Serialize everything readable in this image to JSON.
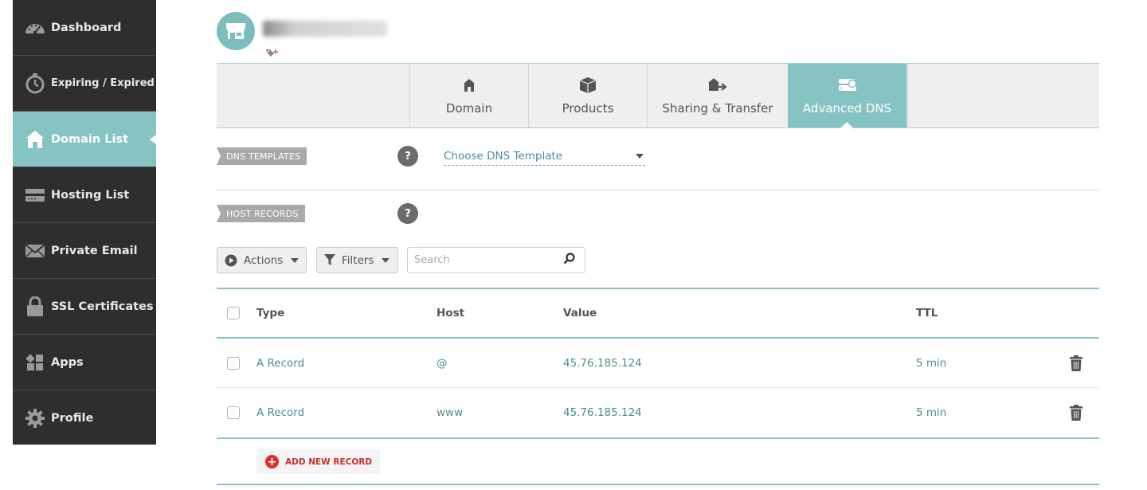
{
  "sidebar": {
    "items": [
      {
        "label": "Dashboard",
        "icon": "speedometer-icon"
      },
      {
        "label": "Expiring / Expired",
        "icon": "stopwatch-icon"
      },
      {
        "label": "Domain List",
        "icon": "home-icon",
        "active": true
      },
      {
        "label": "Hosting List",
        "icon": "server-icon"
      },
      {
        "label": "Private Email",
        "icon": "envelope-icon"
      },
      {
        "label": "SSL Certificates",
        "icon": "lock-icon"
      },
      {
        "label": "Apps",
        "icon": "apps-icon"
      },
      {
        "label": "Profile",
        "icon": "gear-icon"
      }
    ]
  },
  "header": {
    "avatar_icon": "store-icon",
    "tag_icon": "tag-add-icon"
  },
  "tabs": [
    {
      "label": "Domain",
      "icon": "home-icon"
    },
    {
      "label": "Products",
      "icon": "box-icon"
    },
    {
      "label": "Sharing & Transfer",
      "icon": "share-transfer-icon"
    },
    {
      "label": "Advanced DNS",
      "icon": "dns-icon",
      "active": true
    }
  ],
  "dns_templates": {
    "label": "DNS TEMPLATES",
    "help": "?",
    "select_value": "Choose DNS Template"
  },
  "host_records": {
    "label": "HOST RECORDS",
    "help": "?"
  },
  "toolbar": {
    "actions_label": "Actions",
    "filters_label": "Filters",
    "search_placeholder": "Search"
  },
  "table": {
    "columns": {
      "type": "Type",
      "host": "Host",
      "value": "Value",
      "ttl": "TTL"
    },
    "rows": [
      {
        "type": "A Record",
        "host": "@",
        "value": "45.76.185.124",
        "ttl": "5 min"
      },
      {
        "type": "A Record",
        "host": "www",
        "value": "45.76.185.124",
        "ttl": "5 min"
      }
    ],
    "add_label": "ADD NEW RECORD"
  },
  "colors": {
    "accent": "#86c3c3",
    "sidebar_bg": "#2e2e2e",
    "danger": "#d9302a"
  }
}
